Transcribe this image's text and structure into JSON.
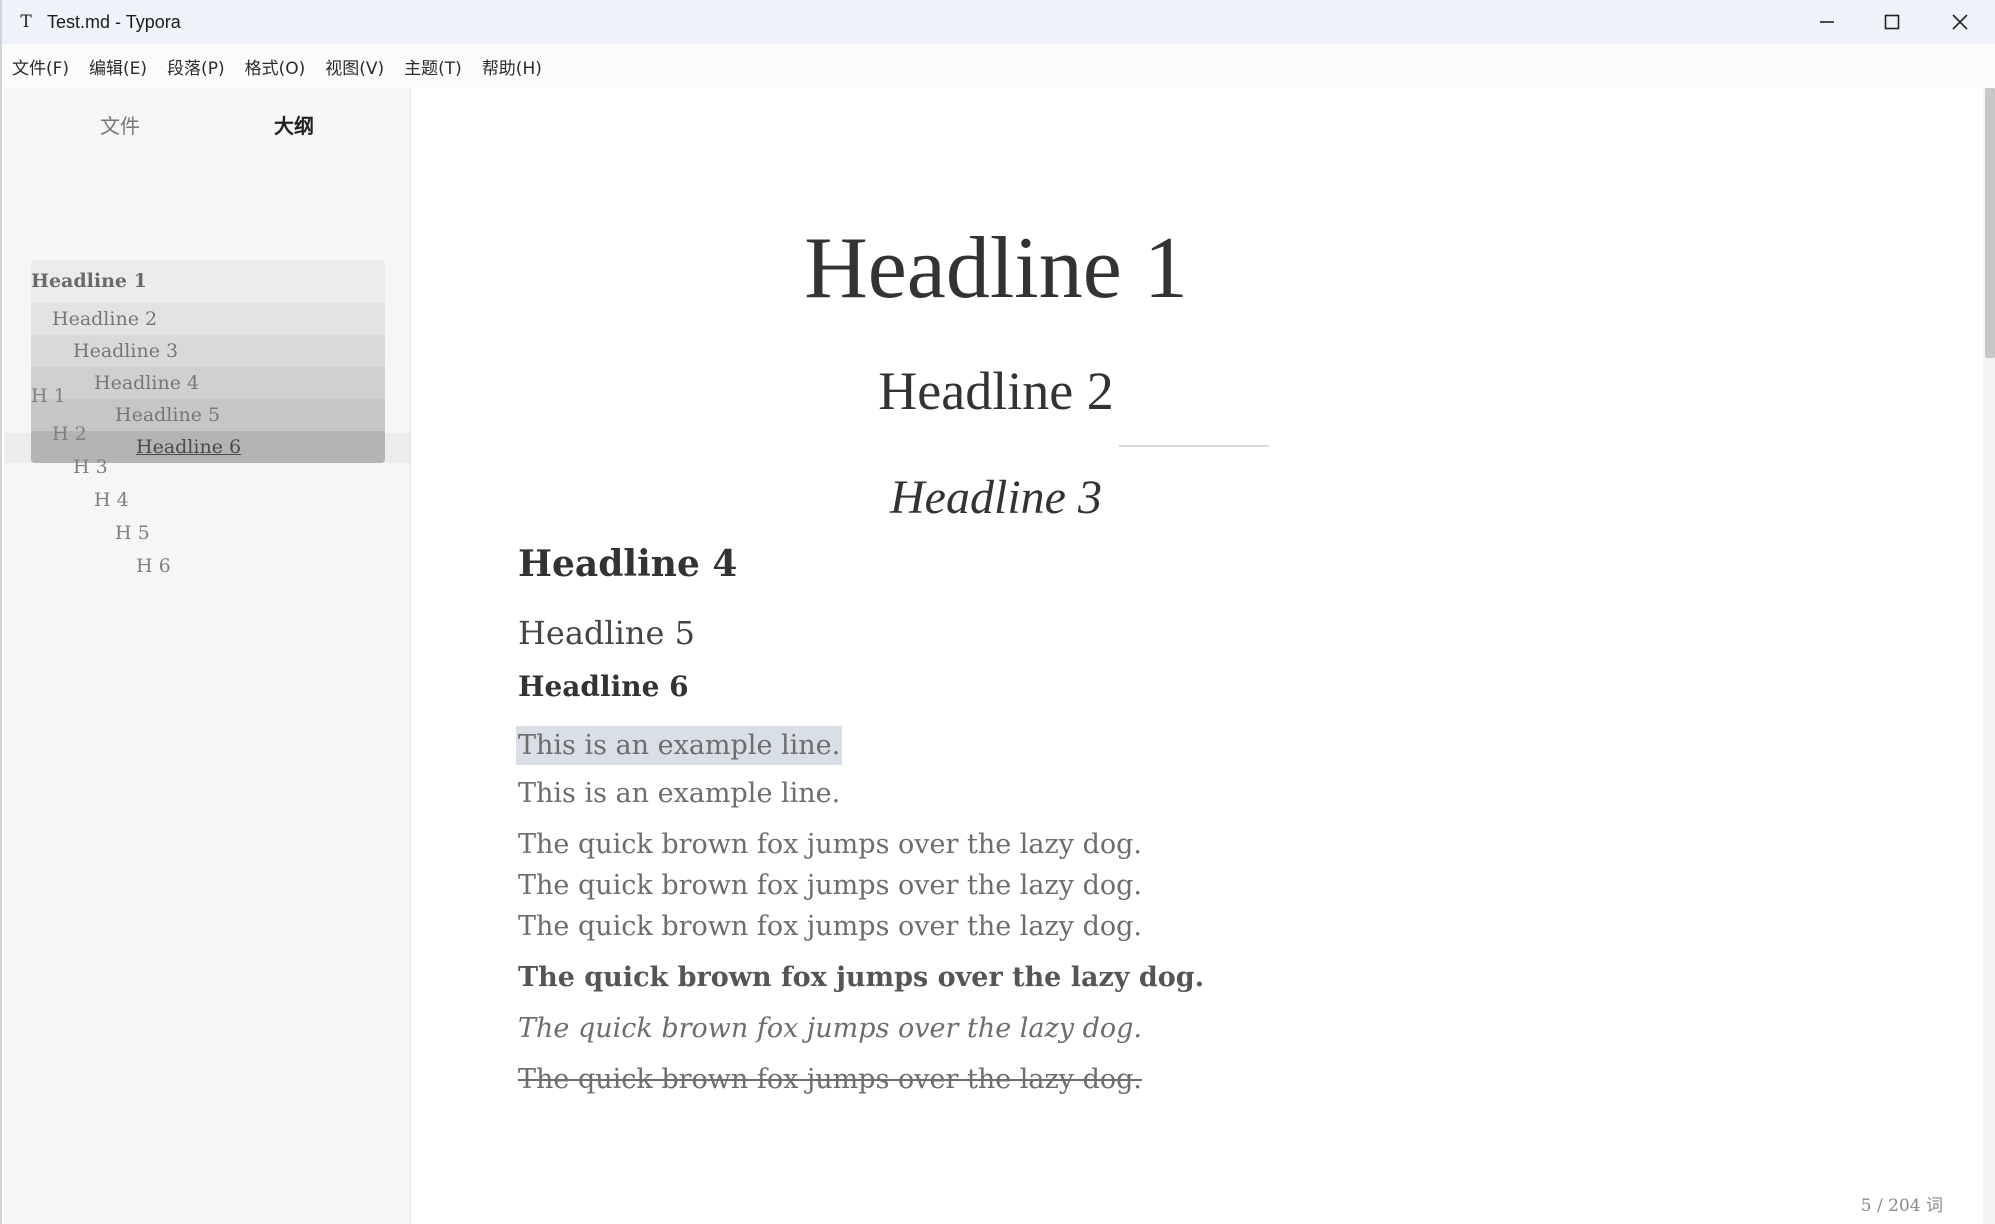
{
  "window": {
    "app_icon_glyph": "T",
    "title": "Test.md - Typora"
  },
  "menu": [
    "文件(F)",
    "编辑(E)",
    "段落(P)",
    "格式(O)",
    "视图(V)",
    "主题(T)",
    "帮助(H)"
  ],
  "sidebar": {
    "tabs": {
      "files": "文件",
      "outline": "大纲"
    },
    "outline_group": [
      "Headline 1",
      "Headline 2",
      "Headline 3",
      "Headline 4",
      "Headline 5",
      "Headline 6"
    ],
    "outline_plain": [
      "H 1",
      "H 2",
      "H 3",
      "H 4",
      "H 5",
      "H 6"
    ],
    "footer": {
      "back_icon": "chevron-left-icon",
      "source_icon": "code-icon"
    }
  },
  "document": {
    "h1": "Headline 1",
    "h2": "Headline 2",
    "h3": "Headline 3",
    "h4": "Headline 4",
    "h5": "Headline 5",
    "h6": "Headline 6",
    "line_highlighted": "This is an example line.",
    "line_plain": "This is an example line.",
    "fox_1": "The quick brown fox jumps over the lazy dog.",
    "fox_2": "The quick brown fox jumps over the lazy dog.",
    "fox_3": "The quick brown fox jumps over the lazy dog.",
    "fox_bold": "The quick brown fox jumps over the lazy dog.",
    "fox_italic": "The quick brown fox jumps over the lazy dog.",
    "fox_strike": "The quick brown fox jumps over the lazy dog."
  },
  "status": {
    "word_count": "5 / 204 词"
  },
  "colors": {
    "titlebar": "#eff3f9",
    "sidebar": "#f6f6f6",
    "text": "#333333",
    "highlight": "#d8dfe7"
  }
}
